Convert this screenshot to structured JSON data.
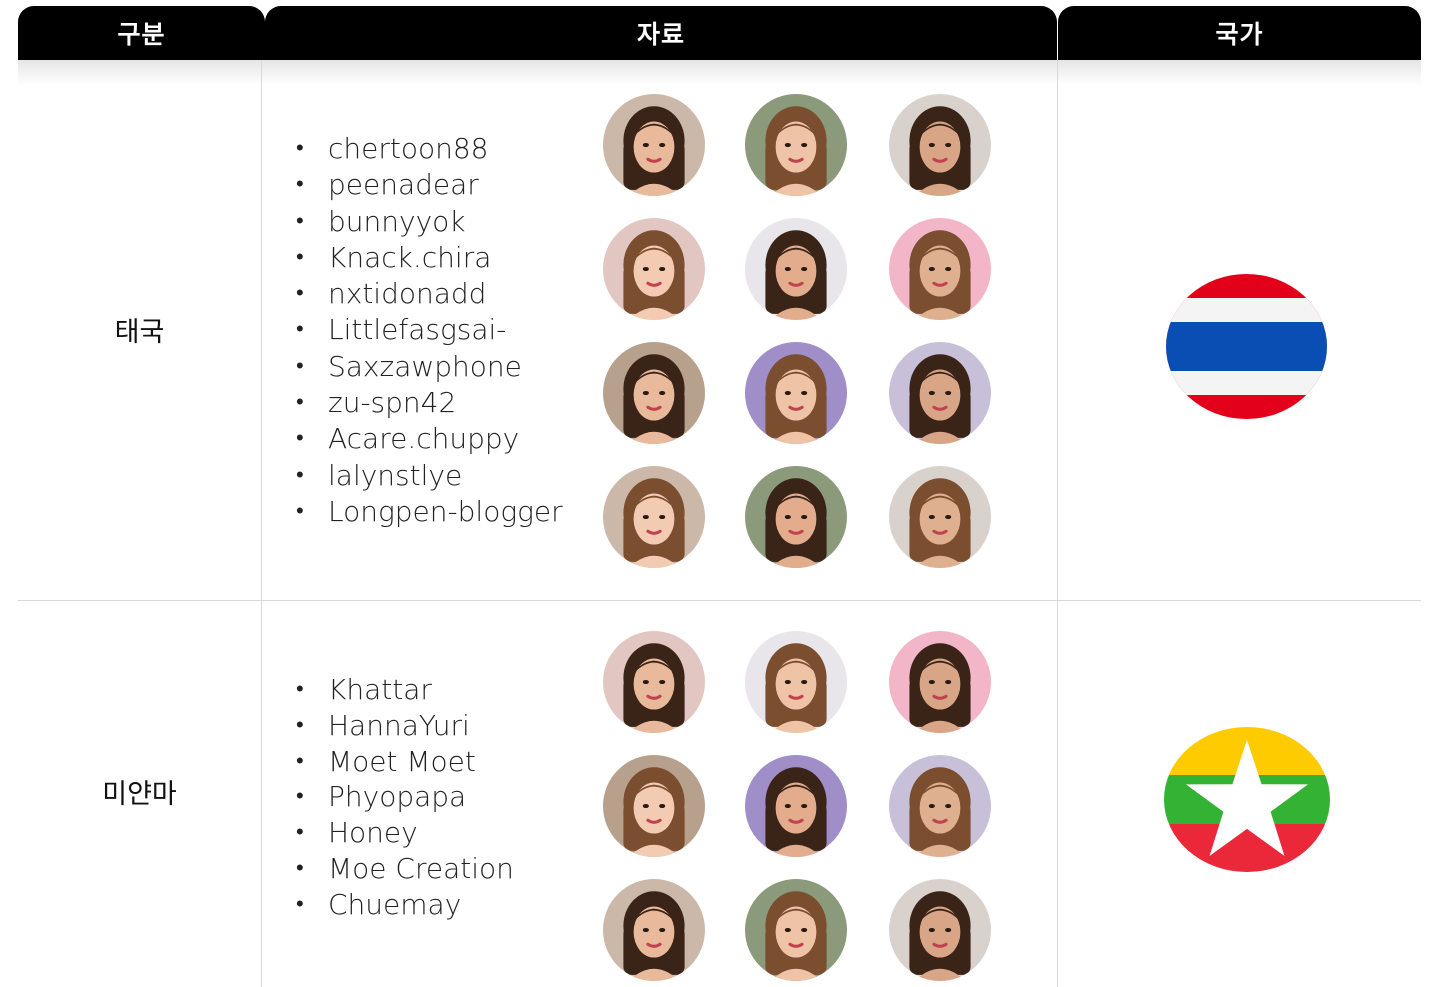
{
  "header": {
    "col1": "구분",
    "col2": "자료",
    "col3": "국가"
  },
  "rows": [
    {
      "country": "태국",
      "flag": {
        "icon": "thailand-flag-icon",
        "colors": [
          "#e2001a",
          "#f4f4f4",
          "#0b4eb3"
        ]
      },
      "influencers": [
        "chertoon88",
        "peenadear",
        "bunnyyok",
        "Knack.chira",
        "nxtidonadd",
        "Littlefasgsai-",
        "Saxzawphone",
        "zu-spn42",
        "Acare.chuppy",
        "lalynstlye",
        "Longpen-blogger"
      ],
      "photos": [
        "profile-photo-1",
        "profile-photo-2",
        "profile-photo-3",
        "profile-photo-4",
        "profile-photo-5",
        "profile-photo-6",
        "profile-photo-7",
        "profile-photo-8",
        "profile-photo-9",
        "profile-photo-10",
        "profile-photo-11",
        "profile-photo-12"
      ]
    },
    {
      "country": "미얀마",
      "flag": {
        "icon": "myanmar-flag-icon",
        "colors": [
          "#fecb00",
          "#34b233",
          "#ea2839",
          "#ffffff"
        ]
      },
      "influencers": [
        "Khattar",
        "HannaYuri",
        "Moet Moet",
        "Phyopapa",
        "Honey",
        "Moe Creation",
        "Chuemay"
      ],
      "photos": [
        "profile-photo-1",
        "profile-photo-2",
        "profile-photo-3",
        "profile-photo-4",
        "profile-photo-5",
        "profile-photo-6",
        "profile-photo-7",
        "profile-photo-8",
        "profile-photo-9"
      ]
    }
  ]
}
